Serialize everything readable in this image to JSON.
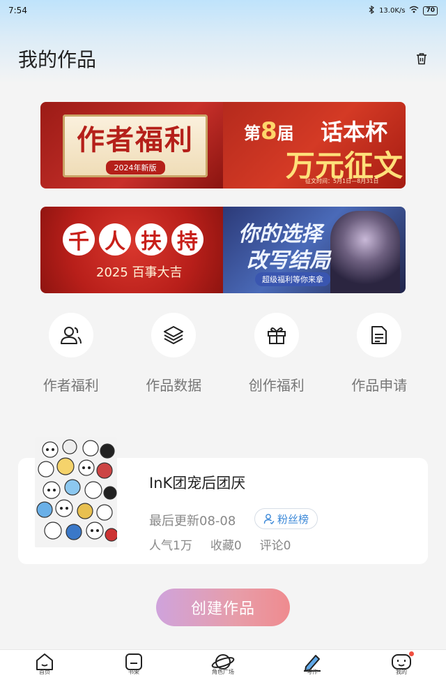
{
  "status_bar": {
    "time": "7:54",
    "network_speed": "13.0K/s",
    "battery": "70"
  },
  "header": {
    "title": "我的作品"
  },
  "banners": [
    {
      "left_title": "作者福利",
      "left_tag": "2024年新版",
      "right_line1_prefix": "第",
      "right_line1_num": "8",
      "right_line1_suffix": "届",
      "right_line1b": "话本杯",
      "right_line2": "万元征文",
      "right_line3": "征文时间：5月1日—8月31日"
    },
    {
      "left_chars": [
        "千",
        "人",
        "扶",
        "持"
      ],
      "left_sub": "2025 百事大吉",
      "right_line1": "你的选择",
      "right_line2": "改写结局",
      "right_line3": "超级福利等你来拿"
    }
  ],
  "features": [
    {
      "label": "作者福利",
      "icon": "users-icon"
    },
    {
      "label": "作品数据",
      "icon": "layers-icon"
    },
    {
      "label": "创作福利",
      "icon": "gift-icon"
    },
    {
      "label": "作品申请",
      "icon": "document-icon"
    }
  ],
  "work": {
    "title": "InK团宠后团厌",
    "updated": "最后更新08-08",
    "fans_label": "粉丝榜",
    "stats": [
      "人气1万",
      "收藏0",
      "评论0"
    ]
  },
  "create_button": "创建作品",
  "tabbar": [
    {
      "label": "首页",
      "icon": "home-icon"
    },
    {
      "label": "书架",
      "icon": "bookshelf-icon"
    },
    {
      "label": "角色广场",
      "icon": "planet-icon"
    },
    {
      "label": "写作",
      "icon": "pen-icon"
    },
    {
      "label": "我的",
      "icon": "profile-icon"
    }
  ],
  "colors": {
    "accent_blue": "#3b88d8",
    "create_gradient_start": "#cfa3dc",
    "create_gradient_end": "#ef8b8f"
  }
}
